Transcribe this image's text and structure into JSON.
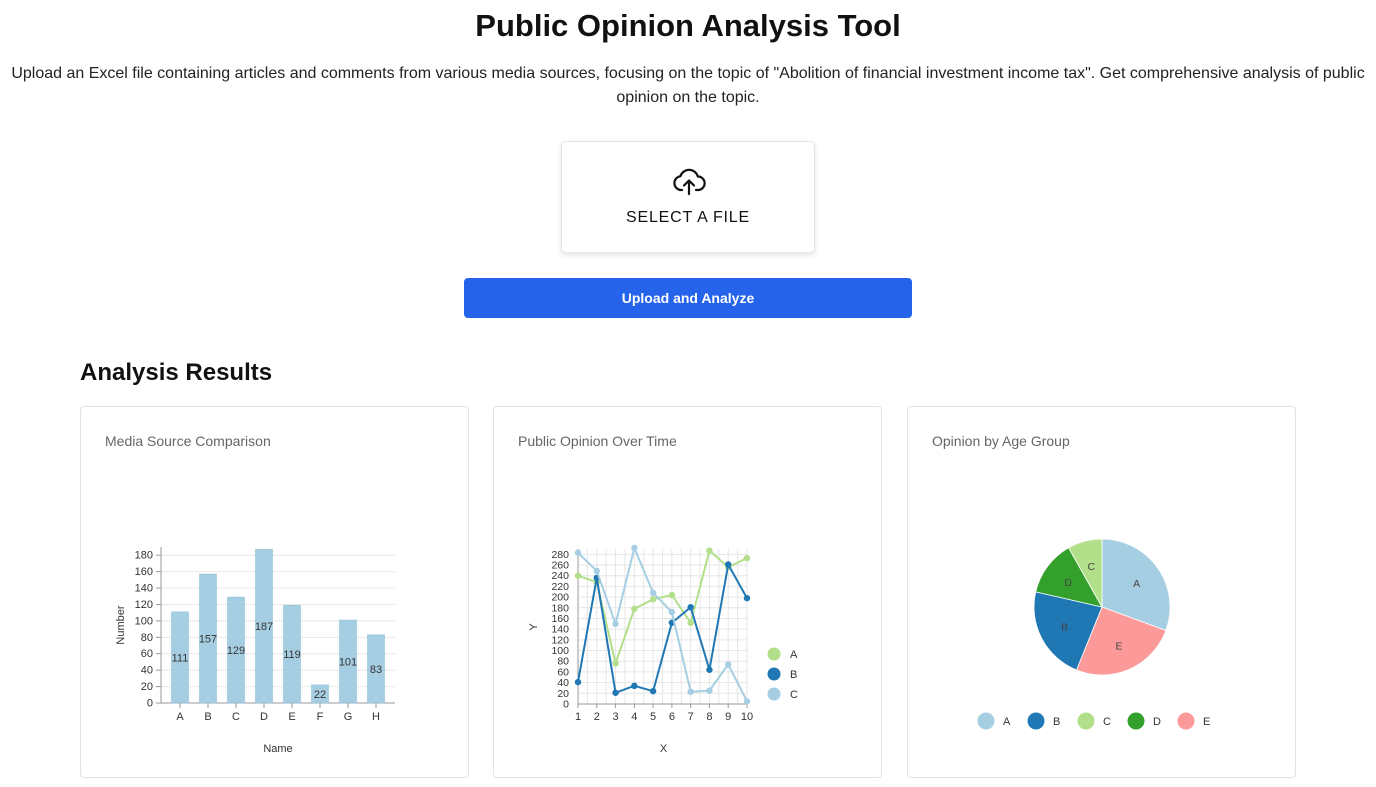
{
  "page": {
    "title": "Public Opinion Analysis Tool",
    "description": "Upload an Excel file containing articles and comments from various media sources, focusing on the topic of \"Abolition of financial investment income tax\". Get comprehensive analysis of public opinion on the topic."
  },
  "upload": {
    "label": "SELECT A FILE",
    "icon": "cloud-upload-icon"
  },
  "action": {
    "button_label": "Upload and Analyze"
  },
  "results": {
    "heading": "Analysis Results",
    "cards": [
      {
        "title": "Media Source Comparison"
      },
      {
        "title": "Public Opinion Over Time"
      },
      {
        "title": "Opinion by Age Group"
      }
    ]
  },
  "colors": {
    "accent": "#2563eb",
    "bar": "#a6cee3",
    "series_a": "#b2df8a",
    "series_b": "#1f78b4",
    "series_c": "#a6cee3",
    "pie_a": "#a6cee3",
    "pie_b": "#1f78b4",
    "pie_c": "#b2df8a",
    "pie_d": "#33a02c",
    "pie_e": "#fb9a99"
  },
  "chart_data": [
    {
      "type": "bar",
      "title": "Media Source Comparison",
      "xlabel": "Name",
      "ylabel": "Number",
      "categories": [
        "A",
        "B",
        "C",
        "D",
        "E",
        "F",
        "G",
        "H"
      ],
      "values": [
        111,
        157,
        129,
        187,
        119,
        22,
        101,
        83
      ],
      "ylim": [
        0,
        190
      ],
      "yticks": [
        0,
        20,
        40,
        60,
        80,
        100,
        120,
        140,
        160,
        180
      ],
      "grid": true
    },
    {
      "type": "line",
      "title": "Public Opinion Over Time",
      "xlabel": "X",
      "ylabel": "Y",
      "x": [
        1,
        2,
        3,
        4,
        5,
        6,
        7,
        8,
        9,
        10
      ],
      "xlim": [
        1,
        10
      ],
      "ylim": [
        0,
        290
      ],
      "yticks": [
        0,
        20,
        40,
        60,
        80,
        100,
        120,
        140,
        160,
        180,
        200,
        220,
        240,
        260,
        280
      ],
      "grid": true,
      "legend": "right",
      "series": [
        {
          "name": "A",
          "values": [
            240,
            228,
            76,
            178,
            196,
            204,
            152,
            287,
            256,
            273
          ]
        },
        {
          "name": "B",
          "values": [
            41,
            236,
            21,
            34,
            24,
            152,
            181,
            64,
            261,
            198
          ]
        },
        {
          "name": "C",
          "values": [
            283,
            249,
            150,
            292,
            208,
            172,
            23,
            25,
            74,
            5
          ]
        }
      ]
    },
    {
      "type": "pie",
      "title": "Opinion by Age Group",
      "legend": "bottom",
      "slices": [
        {
          "label": "A",
          "value": 30
        },
        {
          "label": "E",
          "value": 25
        },
        {
          "label": "B",
          "value": 22
        },
        {
          "label": "D",
          "value": 13
        },
        {
          "label": "C",
          "value": 8
        }
      ],
      "legend_order": [
        "A",
        "B",
        "C",
        "D",
        "E"
      ]
    }
  ]
}
